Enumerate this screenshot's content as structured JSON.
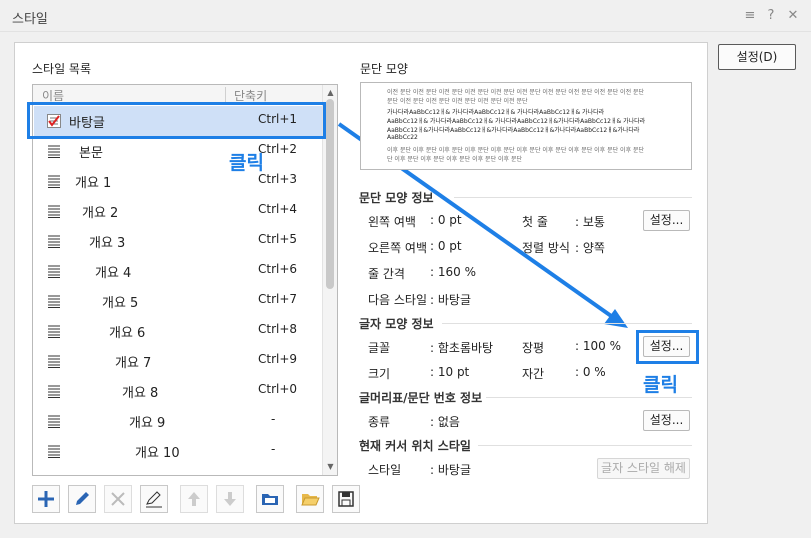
{
  "window": {
    "title": "스타일",
    "controls": [
      "≡",
      "?",
      "✕"
    ]
  },
  "settings_button": "설정(D)",
  "style_list": {
    "label": "스타일 목록",
    "col_name": "이름",
    "col_shortcut": "단축키",
    "items": [
      {
        "name": "바탕글",
        "shortcut": "Ctrl+1"
      },
      {
        "name": "본문",
        "shortcut": "Ctrl+2"
      },
      {
        "name": "개요 1",
        "shortcut": "Ctrl+3"
      },
      {
        "name": "개요 2",
        "shortcut": "Ctrl+4"
      },
      {
        "name": "개요 3",
        "shortcut": "Ctrl+5"
      },
      {
        "name": "개요 4",
        "shortcut": "Ctrl+6"
      },
      {
        "name": "개요 5",
        "shortcut": "Ctrl+7"
      },
      {
        "name": "개요 6",
        "shortcut": "Ctrl+8"
      },
      {
        "name": "개요 7",
        "shortcut": "Ctrl+9"
      },
      {
        "name": "개요 8",
        "shortcut": "Ctrl+0"
      },
      {
        "name": "개요 9",
        "shortcut": "-"
      },
      {
        "name": "개요 10",
        "shortcut": "-"
      }
    ]
  },
  "annotations": {
    "click_1": "클릭",
    "click_2": "클릭"
  },
  "preview": {
    "label": "문단 모양",
    "lines": [
      "이전 문단 이전 문단 이전 문단 이전 문단 이전 문단 이전 문단 이전 문단 이전 문단 이전 문단 이전 문단",
      "문단 이전 문단 이전 문단 이전 문단 이전 문단 이전 문단",
      "가나다라AaBbCc12ㅐ&    가나다라AaBbCc12ㅐ&    가나다라AaBbCc12ㅐ&    가나다라",
      "AaBbCc12ㅐ&  가나다라AaBbCc12ㅐ&  가나다라AaBbCc12ㅐ&가나다라AaBbCc12ㅐ&    가나다라",
      "AaBbCc12ㅐ&가나다라AaBbCc12ㅐ&가나다라AaBbCc12ㅐ&가나다라AaBbCc12ㅐ&가나다라",
      "AaBbCc22",
      "이후 문단 이후 문단 이후 문단 이후 문단 이후 문단 이후 문단 이후 문단 이후 문단 이후 문단 이후 문단",
      "단 이후 문단 이후 문단 이후 문단 이후 문단 이후 문단"
    ]
  },
  "para_info": {
    "title": "문단 모양 정보",
    "left_margin_label": "왼쪽 여백",
    "left_margin": ": 0 pt",
    "first_line_label": "첫 줄",
    "first_line": ": 보통",
    "right_margin_label": "오른쪽 여백",
    "right_margin": ": 0 pt",
    "align_label": "정렬 방식",
    "align": ": 양쪽",
    "line_spacing_label": "줄 간격",
    "line_spacing": ": 160 %",
    "next_style_label": "다음 스타일",
    "next_style": ": 바탕글",
    "button": "설정..."
  },
  "char_info": {
    "title": "글자 모양 정보",
    "font_label": "글꼴",
    "font": ": 함초롬바탕",
    "width_label": "장평",
    "width": ": 100 %",
    "size_label": "크기",
    "size": ": 10 pt",
    "spacing_label": "자간",
    "spacing": ": 0 %",
    "button": "설정..."
  },
  "bullet_info": {
    "title": "글머리표/문단 번호 정보",
    "kind_label": "종류",
    "kind": ": 없음",
    "button": "설정..."
  },
  "cursor_style": {
    "title": "현재 커서 위치 스타일",
    "style_label": "스타일",
    "style": ": 바탕글",
    "button": "글자 스타일 해제"
  },
  "colors": {
    "accent": "#1e7fe6",
    "selection": "#cfe0f7"
  }
}
